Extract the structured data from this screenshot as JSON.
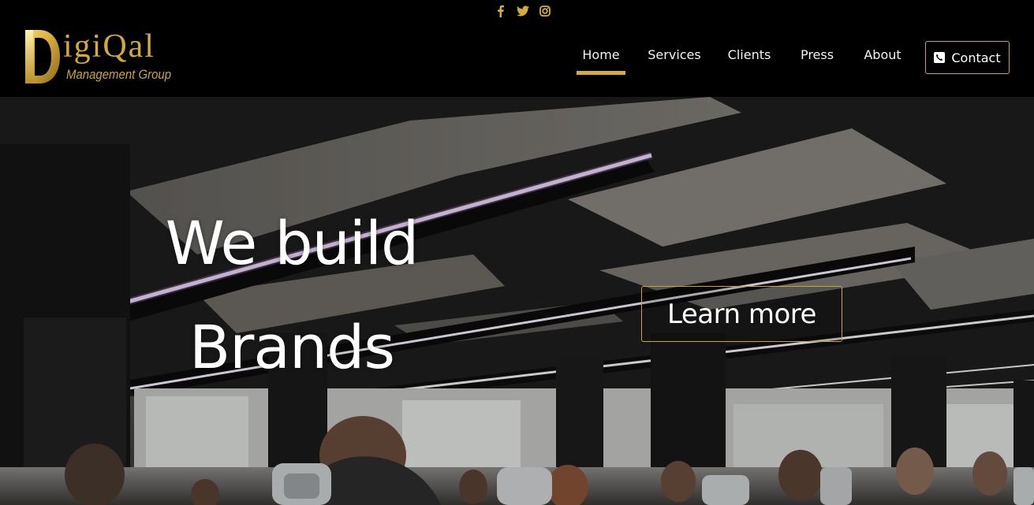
{
  "social": {
    "icons": [
      "facebook-icon",
      "twitter-icon",
      "instagram-icon"
    ],
    "color": "#d6ad3a"
  },
  "brand": {
    "name": "igiQal",
    "subtitle": "Management Group",
    "logo_color": "#d1aa3c"
  },
  "nav": {
    "items": [
      {
        "label": "Home",
        "active": true
      },
      {
        "label": "Services",
        "active": false
      },
      {
        "label": "Clients",
        "active": false
      },
      {
        "label": "Press",
        "active": false
      },
      {
        "label": "About",
        "active": false
      }
    ],
    "contact_label": "Contact",
    "contact_icon": "phone-icon",
    "accent": "#d6ad3a"
  },
  "hero": {
    "title_line1": "We build",
    "title_line2": "Brands",
    "cta_label": "Learn more"
  }
}
